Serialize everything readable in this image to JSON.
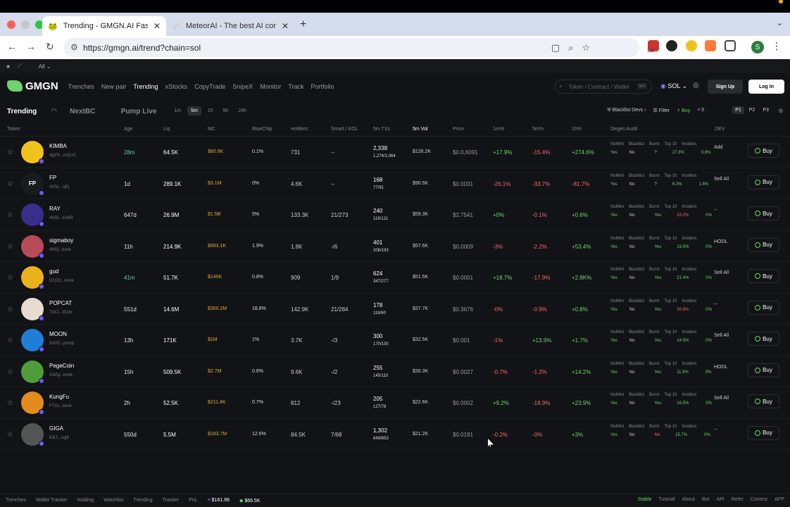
{
  "browser": {
    "tabs": [
      {
        "title": "Trending - GMGN.AI Fast Trac",
        "active": true
      },
      {
        "title": "MeteorAI - The best AI comp",
        "active": false
      }
    ],
    "url": "https://gmgn.ai/trend?chain=sol",
    "ext_badge": "115",
    "profile_initial": "S",
    "bookmarks_all": "All"
  },
  "header": {
    "brand": "GMGN",
    "nav": [
      "Trenches",
      "New pair",
      "Trending",
      "xStocks",
      "CopyTrade",
      "SnipeX",
      "Monitor",
      "Track",
      "Portfolio"
    ],
    "active_nav": "Trending",
    "search_placeholder": "Token / Contract / Wallet",
    "search_kbd": "⌘K",
    "chain": "SOL",
    "signup": "Sign Up",
    "login": "Log In"
  },
  "subbar": {
    "tabs": [
      "Trending",
      "NextBC",
      "Pump Live"
    ],
    "timeframes": [
      "1m",
      "5m",
      "1h",
      "6h",
      "24h"
    ],
    "active_tf": "5m",
    "blacklist": "Blacklist Devs",
    "filter": "Filter",
    "buy": "Buy",
    "buy_amount": "0",
    "pages": [
      "P1",
      "P2",
      "P3"
    ]
  },
  "columns": [
    "Token",
    "Age",
    "Liq",
    "MC",
    "BlueChip",
    "Holders",
    "Smart / KOL",
    "5m TXs",
    "5m Vol",
    "Price",
    "1m%",
    "5m%",
    "1h%",
    "Degen Audit",
    "DEV"
  ],
  "audit_labels": [
    "NoMint",
    "Blacklist",
    "Burnt",
    "Top 10",
    "Insiders"
  ],
  "rows": [
    {
      "name": "KIMBA",
      "addr": "4gVN...mQUC",
      "age": "28m",
      "liq": "64.5K",
      "mc": "$60.9K",
      "bluechip": "0.1%",
      "holders": "731",
      "smart": "--",
      "tx": "2,338",
      "txbs": "1,274/1,064",
      "vol": "$126.2K",
      "price": "$0.0,6091",
      "p1": "+17.9%",
      "p2": "-15.4%",
      "p3": "+274.6%",
      "nomint": "Yes",
      "blacklist": "No",
      "burnt": "?",
      "top10": "27.3%",
      "insiders": "0.8%",
      "dev": "Add",
      "avatar_color": "#f1c21b"
    },
    {
      "name": "FP",
      "addr": "4XSc...qPj",
      "age": "1d",
      "liq": "289.1K",
      "mc": "$3.1M",
      "bluechip": "0%",
      "holders": "4.6K",
      "smart": "--",
      "tx": "168",
      "txbs": "77/91",
      "vol": "$90.5K",
      "price": "$0.0031",
      "p1": "-26.1%",
      "p2": "-33.7%",
      "p3": "-81.7%",
      "nomint": "Yes",
      "blacklist": "No",
      "burnt": "?",
      "top10": "6.3%",
      "insiders": "1.8%",
      "dev": "Sell All",
      "avatar_color": "#1a1b1f"
    },
    {
      "name": "RAY",
      "addr": "4k3D...kX6R",
      "age": "647d",
      "liq": "26.9M",
      "mc": "$1.5B",
      "bluechip": "5%",
      "holders": "133.3K",
      "smart": "21/273",
      "tx": "240",
      "txbs": "119/121",
      "vol": "$59.3K",
      "price": "$2.7541",
      "p1": "+0%",
      "p2": "-0.1%",
      "p3": "+0.6%",
      "nomint": "Yes",
      "blacklist": "No",
      "burnt": "Yes",
      "top10": "33.2%",
      "insiders": "0%",
      "dev": "--",
      "avatar_color": "#3b2d8c"
    },
    {
      "name": "sigmaboy",
      "addr": "4NSj...bonk",
      "age": "11h",
      "liq": "214.9K",
      "mc": "$993.1K",
      "bluechip": "1.9%",
      "holders": "1.8K",
      "smart": "-/6",
      "tx": "401",
      "txbs": "208/193",
      "vol": "$57.6K",
      "price": "$0.0009",
      "p1": "-3%",
      "p2": "-2.2%",
      "p3": "+53.4%",
      "nomint": "Yes",
      "blacklist": "No",
      "burnt": "Yes",
      "top10": "19.5%",
      "insiders": "0%",
      "dev": "HODL",
      "avatar_color": "#b84b5a"
    },
    {
      "name": "gud",
      "addr": "DQ2Q...bonk",
      "age": "41m",
      "liq": "51.7K",
      "mc": "$145K",
      "bluechip": "0.8%",
      "holders": "909",
      "smart": "1/9",
      "tx": "624",
      "txbs": "347/277",
      "vol": "$51.5K",
      "price": "$0.0001",
      "p1": "+18.7%",
      "p2": "-17.9%",
      "p3": "+2.8K%",
      "nomint": "Yes",
      "blacklist": "No",
      "burnt": "Yes",
      "top10": "21.4%",
      "insiders": "0%",
      "dev": "Sell All",
      "avatar_color": "#e9b21a"
    },
    {
      "name": "POPCAT",
      "addr": "7GCi...W2hr",
      "age": "551d",
      "liq": "14.6M",
      "mc": "$360.2M",
      "bluechip": "18.8%",
      "holders": "142.9K",
      "smart": "21/284",
      "tx": "178",
      "txbs": "118/60",
      "vol": "$37.7K",
      "price": "$0.3676",
      "p1": "-0%",
      "p2": "-0.9%",
      "p3": "+0.8%",
      "nomint": "Yes",
      "blacklist": "No",
      "burnt": "Yes",
      "top10": "30.6%",
      "insiders": "0%",
      "dev": "--",
      "avatar_color": "#e8dcd0"
    },
    {
      "name": "MOON",
      "addr": "5nDS...pump",
      "age": "13h",
      "liq": "171K",
      "mc": "$1M",
      "bluechip": "1%",
      "holders": "3.7K",
      "smart": "-/3",
      "tx": "300",
      "txbs": "170/130",
      "vol": "$32.5K",
      "price": "$0.001",
      "p1": "-1%",
      "p2": "+13.9%",
      "p3": "+1.7%",
      "nomint": "Yes",
      "blacklist": "No",
      "burnt": "Yes",
      "top10": "14.5%",
      "insiders": "0%",
      "dev": "Sell All",
      "avatar_color": "#1f7ed6"
    },
    {
      "name": "PegeCoin",
      "addr": "G4Zg...bonk",
      "age": "15h",
      "liq": "509.5K",
      "mc": "$2.7M",
      "bluechip": "0.6%",
      "holders": "9.6K",
      "smart": "-/2",
      "tx": "255",
      "txbs": "145/110",
      "vol": "$30.3K",
      "price": "$0.0027",
      "p1": "-0.7%",
      "p2": "-1.2%",
      "p3": "+14.2%",
      "nomint": "Yes",
      "blacklist": "No",
      "burnt": "Yes",
      "top10": "11.9%",
      "insiders": "0%",
      "dev": "HODL",
      "avatar_color": "#4e9d3a"
    },
    {
      "name": "KungFu",
      "addr": "FTXv...bonk",
      "age": "2h",
      "liq": "52.5K",
      "mc": "$211.4K",
      "bluechip": "0.7%",
      "holders": "812",
      "smart": "-/23",
      "tx": "205",
      "txbs": "127/78",
      "vol": "$22.6K",
      "price": "$0.0002",
      "p1": "+9.2%",
      "p2": "-18.9%",
      "p3": "+23.9%",
      "nomint": "Yes",
      "blacklist": "No",
      "burnt": "Yes",
      "top10": "16.5%",
      "insiders": "0%",
      "dev": "Sell All",
      "avatar_color": "#e58b1c"
    },
    {
      "name": "GIGA",
      "addr": "63Lf...cqj8",
      "age": "550d",
      "liq": "5.5M",
      "mc": "$183.7M",
      "bluechip": "12.6%",
      "holders": "84.5K",
      "smart": "7/68",
      "tx": "1,302",
      "txbs": "649/653",
      "vol": "$21.2K",
      "price": "$0.0191",
      "p1": "-0.2%",
      "p2": "-0%",
      "p3": "+3%",
      "nomint": "Yes",
      "blacklist": "No",
      "burnt": "No",
      "top10": "15.7%",
      "insiders": "0%",
      "dev": "--",
      "avatar_color": "#555"
    }
  ],
  "buy_label": "Buy",
  "footer": {
    "items": [
      "Trenches",
      "Wallet Tracker",
      "Holding",
      "Watchlist",
      "Trending",
      "Tracker",
      "PnL"
    ],
    "sol_price": "$161.96",
    "vol": "$66.5K",
    "right": [
      "Stable",
      "Tutorial",
      "About",
      "Bot",
      "API",
      "Refer",
      "Contest",
      "APP"
    ]
  }
}
